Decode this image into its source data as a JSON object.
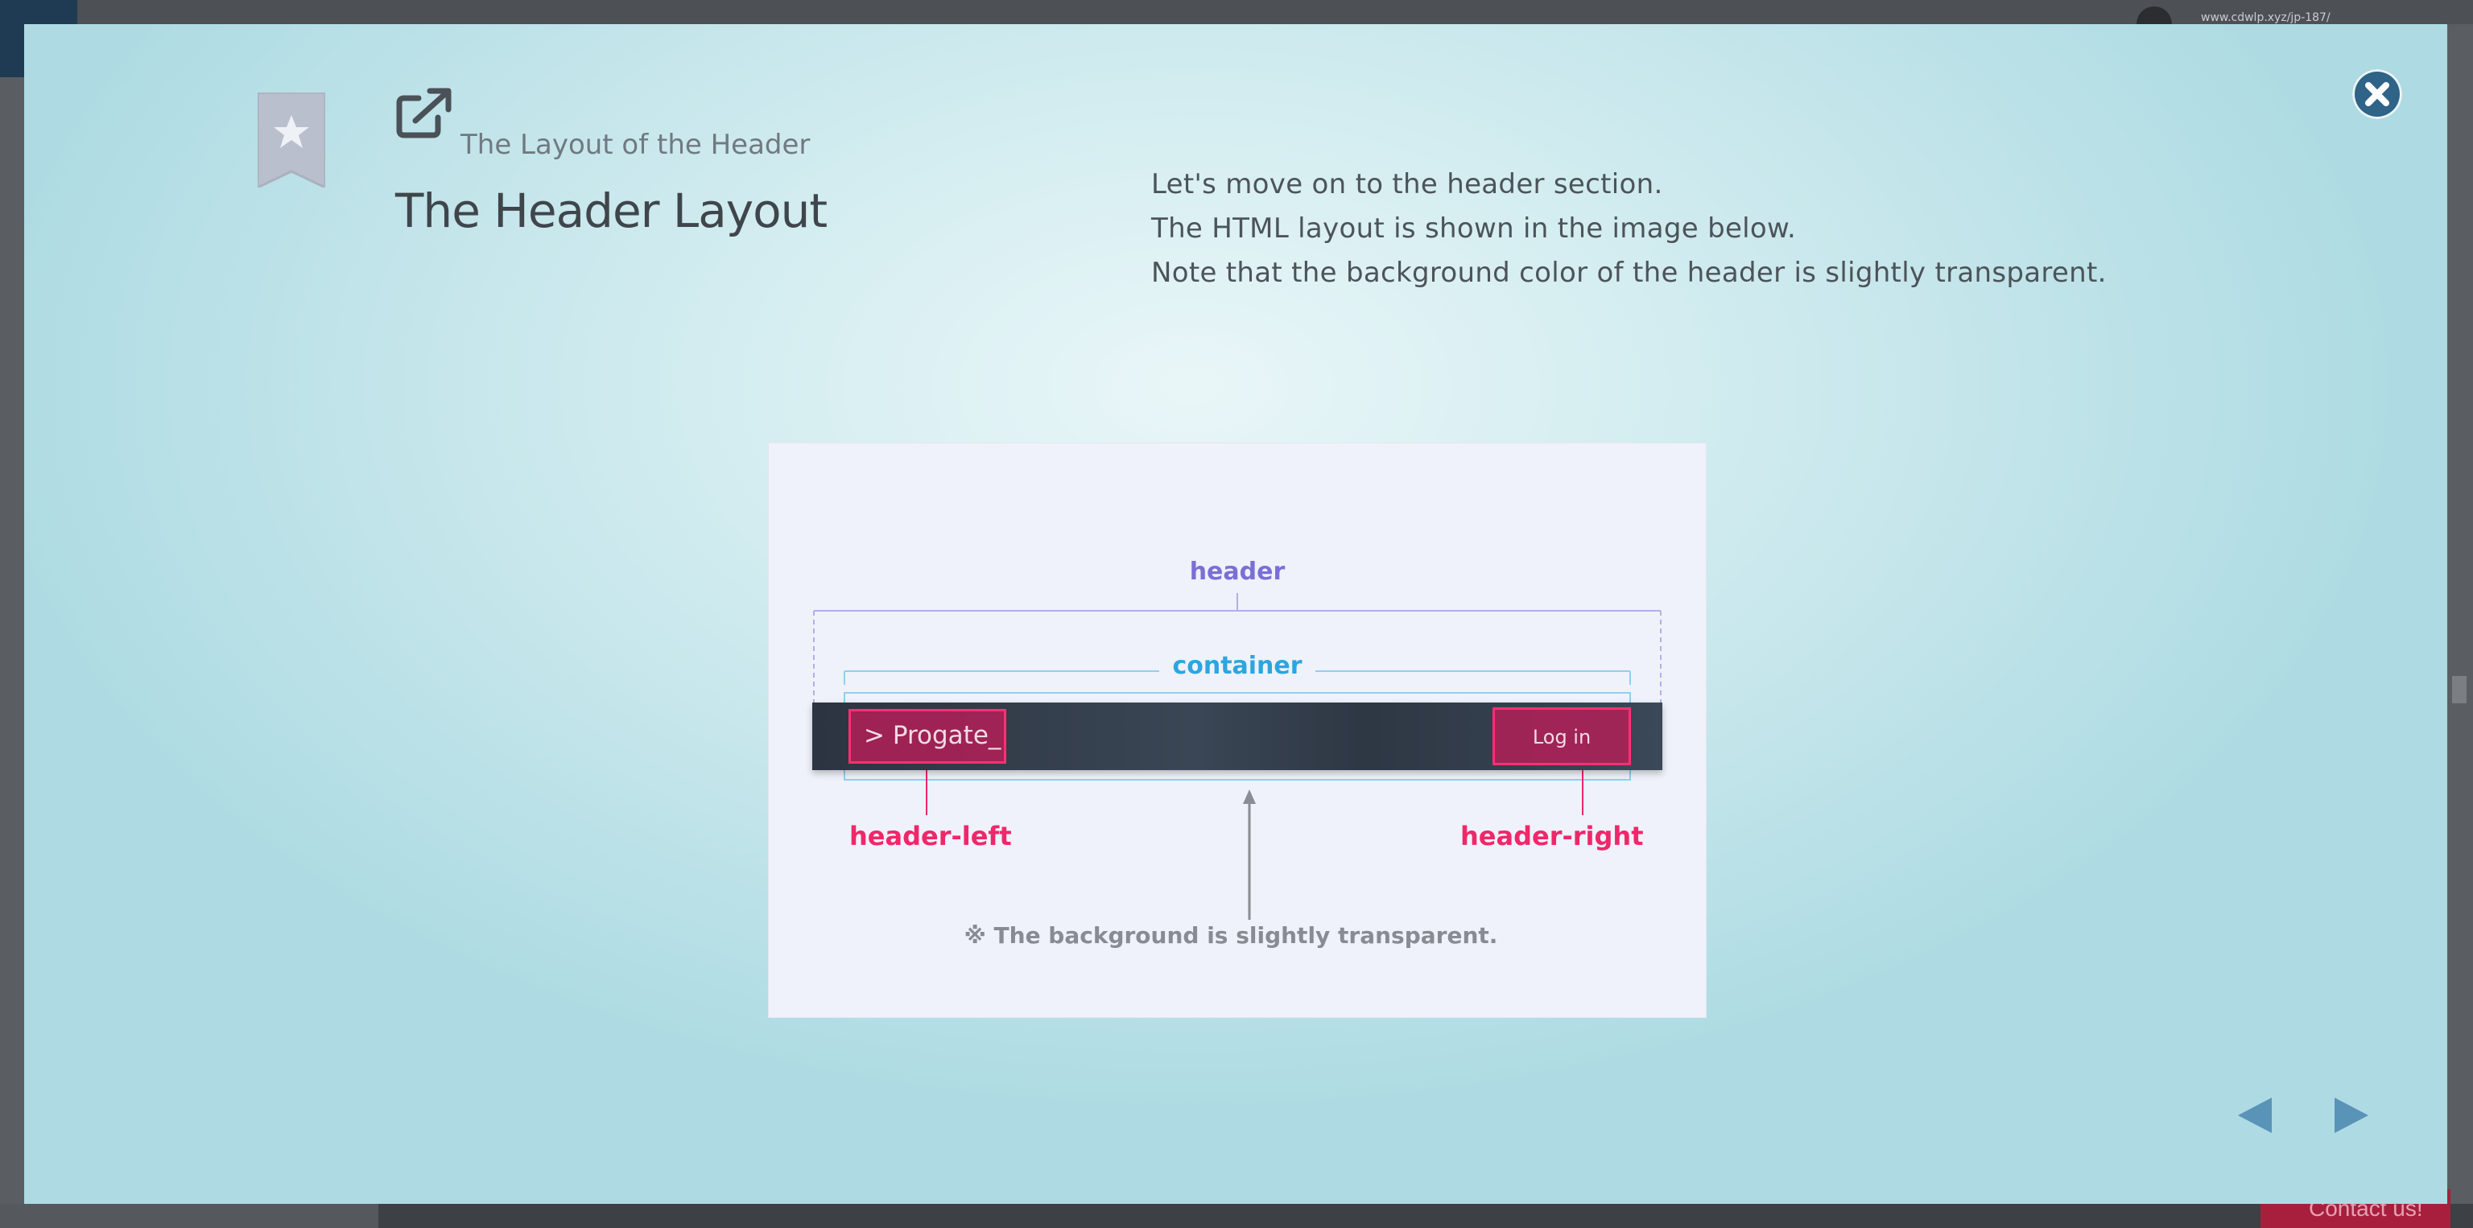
{
  "background": {
    "url_text": "www.cdwlp.xyz/jp-187/",
    "contact_label": "Contact us!"
  },
  "modal": {
    "subtitle": "The Layout of the Header",
    "title": "The Header Layout",
    "description": [
      "Let's move on to the header section.",
      "The HTML layout is shown in the image below.",
      "Note that the background color of the header is slightly transparent."
    ],
    "icons": {
      "bookmark": "bookmark-star-icon",
      "external": "external-link-icon",
      "close": "close-icon",
      "prev": "arrow-left-icon",
      "next": "arrow-right-icon"
    }
  },
  "diagram": {
    "header_label": "header",
    "container_label": "container",
    "logo_text": "> Progate_",
    "login_text": "Log in",
    "header_left_label": "header-left",
    "header_right_label": "header-right",
    "note": "※ The background is slightly transparent.",
    "colors": {
      "header": "#7a6fd6",
      "container": "#2ba6e0",
      "accent": "#f0276a"
    }
  }
}
